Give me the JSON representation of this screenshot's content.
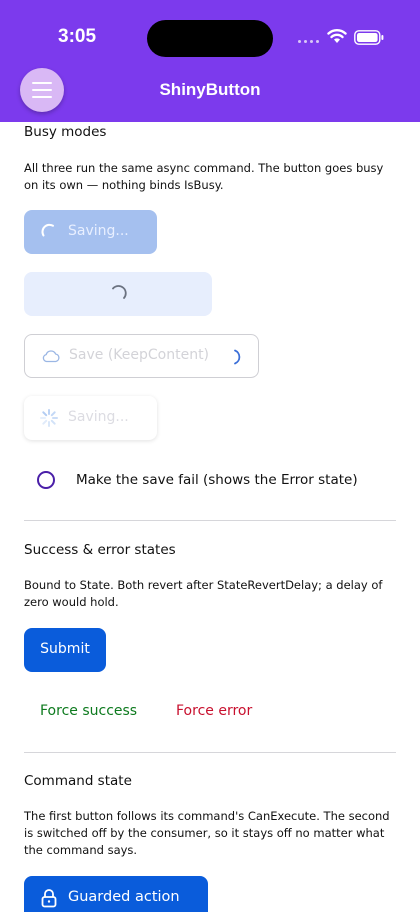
{
  "status_bar": {
    "time": "3:05"
  },
  "app_bar": {
    "title": "ShinyButton",
    "menu_icon": "hamburger-icon"
  },
  "busy_modes": {
    "heading": "Busy modes",
    "description": "All three run the same async command. The button goes busy on its own — nothing binds IsBusy.",
    "button_spinner_label": "Saving...",
    "button_keep_content_label": "Save (KeepContent)",
    "button_dots_label": "Saving...",
    "fail_toggle_label": "Make the save fail (shows the Error state)"
  },
  "success_error": {
    "heading": "Success & error states",
    "description": "Bound to State. Both revert after StateRevertDelay; a delay of zero would hold.",
    "submit_label": "Submit",
    "force_success_label": "Force success",
    "force_error_label": "Force error",
    "success_color": "#0d7a1e",
    "error_color": "#c8102e"
  },
  "command_state": {
    "heading": "Command state",
    "description": "The first button follows its command's CanExecute. The second is switched off by the consumer, so it stays off no matter what the command says.",
    "guarded_label": "Guarded action",
    "guarded_icon": "lock-icon"
  },
  "colors": {
    "accent": "#7c3aed",
    "primary_button": "#0a5cdb"
  }
}
